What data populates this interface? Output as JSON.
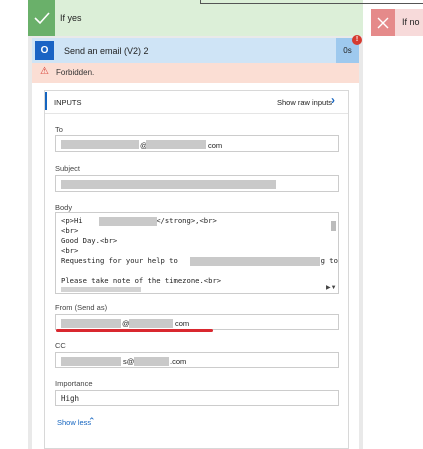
{
  "branches": {
    "yes_label": "If yes",
    "no_label": "If no"
  },
  "action": {
    "title": "Send an email (V2) 2",
    "duration": "0s",
    "error_badge": "!",
    "error_message": "Forbidden."
  },
  "inputs": {
    "header": "INPUTS",
    "show_raw": "Show raw inputs",
    "fields": {
      "to": {
        "label": "To",
        "value_suffix_at": "@",
        "value_suffix": "com"
      },
      "subject": {
        "label": "Subject"
      },
      "body": {
        "label": "Body",
        "lines": [
          "<p>Hi             Team</strong>,<br>",
          "<br>",
          "Good Day.<br>",
          "<br>",
          "Requesting for your help to                         according to the",
          "",
          "Please take note of the timezone.<br>"
        ]
      },
      "from": {
        "label": "From (Send as)",
        "value_at": "@",
        "value_suffix": "com"
      },
      "cc": {
        "label": "CC",
        "value_at": "s@",
        "value_suffix": ".com"
      },
      "importance": {
        "label": "Importance",
        "value": "High"
      }
    },
    "show_less": "Show less"
  },
  "colors": {
    "yes_green": "#6ab06a",
    "no_red": "#e58a8a",
    "action_blue": "#cfe4f6",
    "error_bg": "#fbded4",
    "link_blue": "#1565c0",
    "highlight_red": "#d9282f"
  }
}
